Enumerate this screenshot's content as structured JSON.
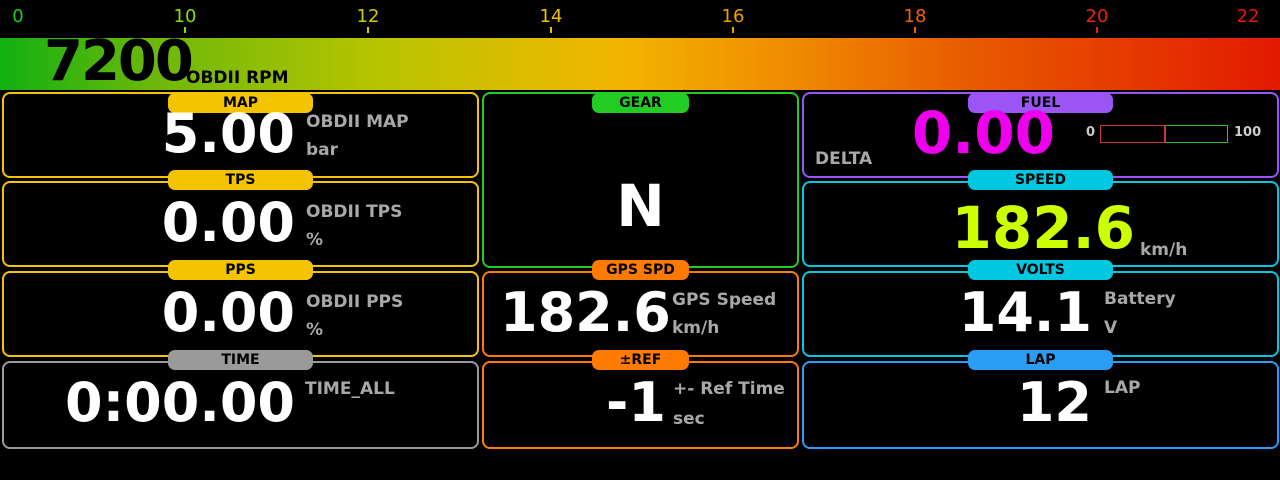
{
  "rpm_scale": {
    "ticks": [
      {
        "label": "0",
        "color": "#22cc22"
      },
      {
        "label": "10",
        "color": "#88dd00"
      },
      {
        "label": "12",
        "color": "#cccc00"
      },
      {
        "label": "14",
        "color": "#f0c000"
      },
      {
        "label": "16",
        "color": "#f0a000"
      },
      {
        "label": "18",
        "color": "#f06000"
      },
      {
        "label": "20",
        "color": "#ee2200"
      },
      {
        "label": "22",
        "color": "#ee1111"
      }
    ]
  },
  "rpm": {
    "value": "7200",
    "label": "OBDII RPM"
  },
  "panels": {
    "map": {
      "tag": "MAP",
      "value": "5.00",
      "label": "OBDII MAP",
      "unit": "bar",
      "color": "#f5c400"
    },
    "tps": {
      "tag": "TPS",
      "value": "0.00",
      "label": "OBDII TPS",
      "unit": "%",
      "color": "#f5c400"
    },
    "pps": {
      "tag": "PPS",
      "value": "0.00",
      "label": "OBDII PPS",
      "unit": "%",
      "color": "#f5c400"
    },
    "time": {
      "tag": "TIME",
      "value": "0:00.00",
      "label": "TIME_ALL",
      "color": "#9a9a9a"
    },
    "gear": {
      "tag": "GEAR",
      "value": "N",
      "color": "#22cc22"
    },
    "gps_spd": {
      "tag": "GPS SPD",
      "value": "182.6",
      "label": "GPS Speed",
      "unit": "km/h",
      "color": "#ff7a00"
    },
    "ref": {
      "tag": "±REF",
      "value": "-1",
      "label": "+- Ref Time",
      "unit": "sec",
      "color": "#ff7a00"
    },
    "fuel": {
      "tag": "FUEL",
      "value": "0.00",
      "label": "DELTA",
      "scale_min": "0",
      "scale_max": "100",
      "color": "#9b55f5",
      "value_color": "#ee00ee"
    },
    "speed": {
      "tag": "SPEED",
      "value": "182.6",
      "unit": "km/h",
      "color": "#00c8e0",
      "value_color": "#ccff00"
    },
    "volts": {
      "tag": "VOLTS",
      "value": "14.1",
      "label": "Battery",
      "unit": "V",
      "color": "#00c8e0"
    },
    "lap": {
      "tag": "LAP",
      "value": "12",
      "label": "LAP",
      "color": "#2a9df4"
    }
  }
}
